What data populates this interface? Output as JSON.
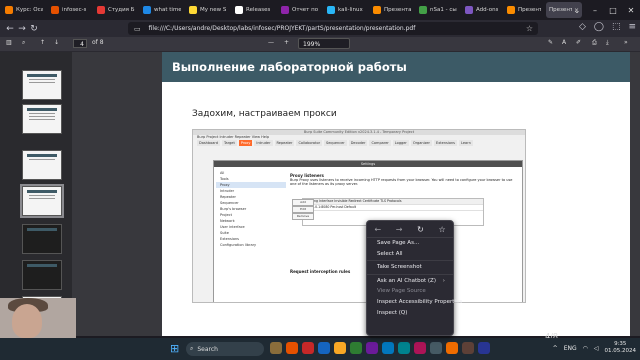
{
  "tabs": [
    {
      "label": "Курс: Оса",
      "color": "#f57c00"
    },
    {
      "label": "infosec-s",
      "color": "#e65100"
    },
    {
      "label": "Студия Б",
      "color": "#e53935"
    },
    {
      "label": "what time",
      "color": "#1e88e5"
    },
    {
      "label": "My new S",
      "color": "#fdd835"
    },
    {
      "label": "Releases",
      "color": "#ffffff"
    },
    {
      "label": "Отчет по",
      "color": "#8e24aa"
    },
    {
      "label": "kali-linux",
      "color": "#29b6f6"
    },
    {
      "label": "Презента",
      "color": "#fb8c00"
    },
    {
      "label": "nSa1 - сы",
      "color": "#43a047"
    },
    {
      "label": "Add-ons",
      "color": "#7e57c2"
    },
    {
      "label": "Презента",
      "color": "#fb8c00"
    },
    {
      "label": "Презента",
      "color": "#fb8c00",
      "active": true
    }
  ],
  "url": "file:///C:/Users/andre/Desktop/labs/infosec/PROJYEKT/partS/presentation/presentation.pdf",
  "pdf_toolbar": {
    "page": "4",
    "of": "of 8",
    "zoom": "199%",
    "minus": "—",
    "plus": "+"
  },
  "slide": {
    "title": "Выполнение лабораторной работы",
    "subtitle": "Задохим, настраиваем прокси",
    "page_number": "4/8"
  },
  "burp": {
    "window_title": "Burp Suite Community Edition v2024.3.1.4 - Temporary Project",
    "menu": "Burp  Project  Intruder  Repeater  View  Help",
    "tabs": [
      "Dashboard",
      "Target",
      "Proxy",
      "Intruder",
      "Repeater",
      "Collaborator",
      "Sequencer",
      "Decoder",
      "Comparer",
      "Logger",
      "Organizer",
      "Extensions",
      "Learn"
    ],
    "settings_title": "Settings",
    "side": [
      "All",
      "User",
      "Project",
      "Tools",
      "Proxy",
      "Intruder",
      "Repeater",
      "Sequencer",
      "Burp's browser",
      "Project",
      "Network",
      "User interface",
      "Suite",
      "Extensions",
      "Configuration library"
    ],
    "section": "Proxy listeners",
    "desc": "Burp Proxy uses listeners to receive incoming HTTP requests from your browser. You will need to configure your browser to use one of the listeners as its proxy server.",
    "table_headers": "Running   Interface   Invisible   Redirect   Certificate   TLS Protocols",
    "table_row": "127.0.0.1:8080                             Per-host      Default",
    "buttons": [
      "Add",
      "Edit",
      "Remove"
    ],
    "section2": "Request interception rules"
  },
  "context_menu": {
    "items": [
      {
        "label": "Save Page As...",
        "disabled": false
      },
      {
        "label": "Select All",
        "disabled": false
      },
      {
        "label": "Take Screenshot",
        "disabled": false
      },
      {
        "label": "Ask an AI Chatbot (Z)",
        "disabled": false,
        "submenu": true
      },
      {
        "label": "View Page Source",
        "disabled": true
      },
      {
        "label": "Inspect Accessibility Properties",
        "disabled": false
      },
      {
        "label": "Inspect (Q)",
        "disabled": false
      }
    ]
  },
  "taskbar": {
    "search": "Search",
    "lang": "ENG",
    "time": "9:35",
    "date": "01.05.2024"
  }
}
